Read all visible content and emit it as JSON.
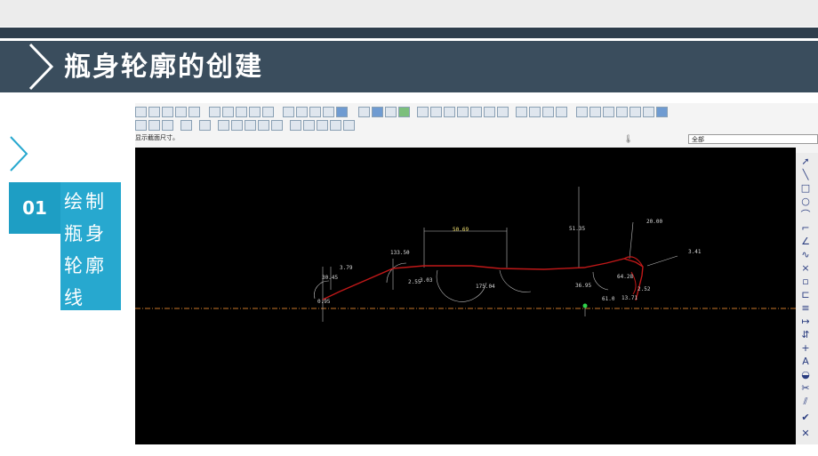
{
  "slide": {
    "title": "瓶身轮廓的创建",
    "step_number": "01",
    "step_lines": [
      "绘制",
      "瓶身",
      "轮廓",
      "线"
    ]
  },
  "app": {
    "status_message": "显示截面尺寸。",
    "filter_value": "全部"
  },
  "dimensions": [
    {
      "label": "50.69",
      "color": "yellow"
    },
    {
      "label": "51.35",
      "color": "white"
    },
    {
      "label": "20.00",
      "color": "white"
    },
    {
      "label": "3.41",
      "color": "white"
    },
    {
      "label": "133.5θ",
      "color": "white"
    },
    {
      "label": "3.79",
      "color": "white"
    },
    {
      "label": "30.45",
      "color": "white"
    },
    {
      "label": "2.55",
      "color": "white"
    },
    {
      "label": "3.03",
      "color": "white"
    },
    {
      "label": "175.04",
      "color": "white"
    },
    {
      "label": "36.95",
      "color": "white"
    },
    {
      "label": "64.28",
      "color": "white"
    },
    {
      "label": "2.52",
      "color": "white"
    },
    {
      "label": "61.0",
      "color": "white"
    },
    {
      "label": "13.71",
      "color": "white"
    },
    {
      "label": "0.95",
      "color": "white"
    }
  ],
  "right_toolbar_icons": [
    "select-arrow-icon",
    "line-icon",
    "rectangle-icon",
    "circle-icon",
    "arc-icon",
    "fillet-icon",
    "chamfer-icon",
    "spline-icon",
    "point-icon",
    "coord-system-icon",
    "offset-icon",
    "thicken-icon",
    "dimension-icon",
    "modify-icon",
    "constraint-icon",
    "text-icon",
    "palette-icon",
    "trim-icon",
    "mirror-icon",
    "done-icon",
    "cancel-icon"
  ],
  "colors": {
    "header_bg": "#3a4d5d",
    "accent_blue": "#27a8cf",
    "sketch_red": "#c01818",
    "canvas_bg": "#000000"
  }
}
